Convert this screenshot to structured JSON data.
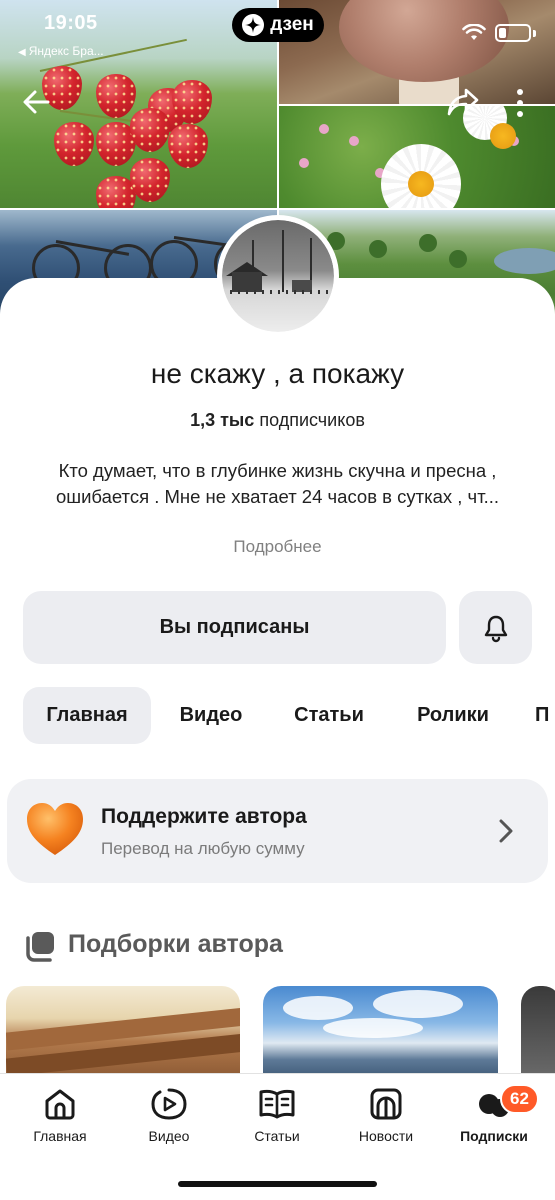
{
  "status_bar": {
    "time": "19:05",
    "back_app": "Яндекс Бра..."
  },
  "header": {
    "brand": "дзен"
  },
  "channel": {
    "title": "не скажу , а покажу",
    "subscribers_count": "1,3 тыс",
    "subscribers_label": "подписчиков",
    "description_line1": "Кто думает, что в глубинке жизнь скучна и пресна ,",
    "description_line2": "ошибается . Мне не хватает 24 часов в сутках , чт...",
    "more_label": "Подробнее"
  },
  "actions": {
    "subscribed_label": "Вы подписаны",
    "bell_icon": "bell-icon"
  },
  "tabs": [
    {
      "label": "Главная",
      "active": true
    },
    {
      "label": "Видео",
      "active": false
    },
    {
      "label": "Статьи",
      "active": false
    },
    {
      "label": "Ролики",
      "active": false
    },
    {
      "label": "П",
      "active": false
    }
  ],
  "support": {
    "title": "Поддержите автора",
    "subtitle": "Перевод на любую сумму",
    "icon": "heart-icon"
  },
  "collections": {
    "title": "Подборки автора"
  },
  "bottom_nav": {
    "items": [
      {
        "label": "Главная",
        "icon": "home-icon"
      },
      {
        "label": "Видео",
        "icon": "video-icon"
      },
      {
        "label": "Статьи",
        "icon": "articles-icon"
      },
      {
        "label": "Новости",
        "icon": "news-icon"
      },
      {
        "label": "Подписки",
        "icon": "subscriptions-icon"
      }
    ],
    "subscriptions_badge": "62"
  },
  "colors": {
    "accent_badge": "#ff5a28",
    "button_bg": "#ecedf1",
    "heart": "#f58220"
  }
}
